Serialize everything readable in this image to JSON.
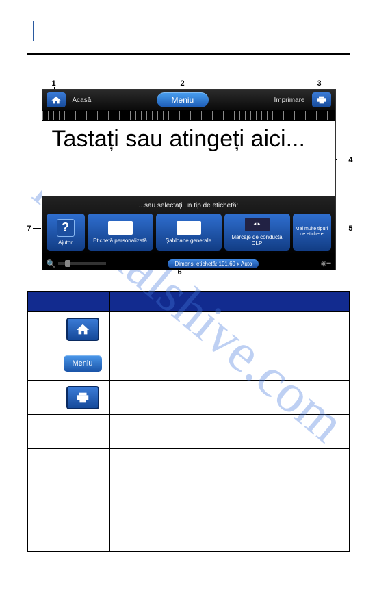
{
  "watermark": "manualshive.com",
  "device": {
    "home_label": "Acasă",
    "menu_label": "Meniu",
    "print_label": "Imprimare",
    "editor_text": "Tastați sau atingeți aici...",
    "or_text": "...sau selectați un tip de etichetă:",
    "help_label": "Ajutor",
    "tile1_label": "Etichetă personalizată",
    "tile2_label": "Șabloane generale",
    "tile3_label": "Marcaje de conductă CLP",
    "more_label": "Mai multe tipuri de etichete",
    "status_label": "Dimens. etichetă: 101,60 x Auto"
  },
  "callouts": {
    "n1": "1",
    "n2": "2",
    "n3": "3",
    "n4": "4",
    "n5": "5",
    "n6": "6",
    "n7": "7"
  },
  "legend": {
    "menu_label": "Meniu"
  }
}
